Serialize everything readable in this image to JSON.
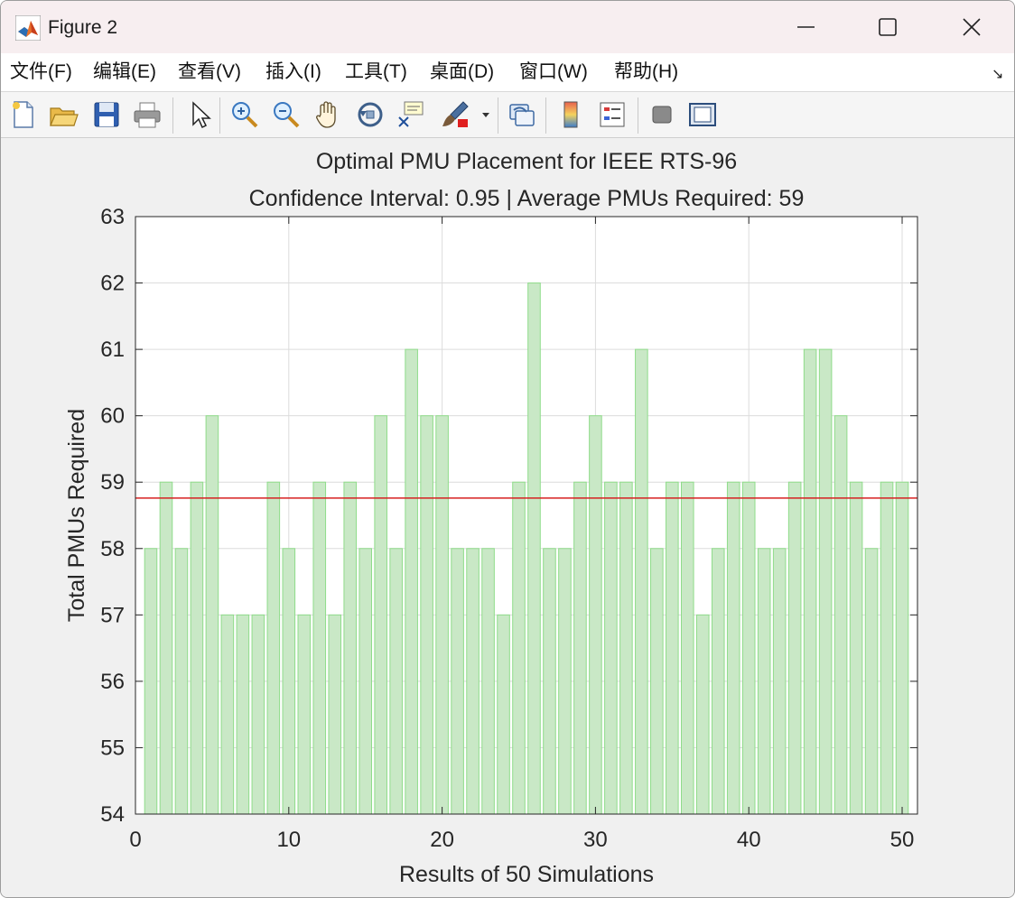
{
  "window": {
    "title": "Figure 2",
    "icon": "matlab-icon"
  },
  "menu": {
    "items": [
      "文件(F)",
      "编辑(E)",
      "查看(V)",
      "插入(I)",
      "工具(T)",
      "桌面(D)",
      "窗口(W)",
      "帮助(H)"
    ]
  },
  "toolbar": {
    "buttons": [
      "new-figure-icon",
      "open-file-icon",
      "save-icon",
      "print-icon",
      "pointer-icon",
      "zoom-in-icon",
      "zoom-out-icon",
      "pan-hand-icon",
      "rotate-3d-icon",
      "data-cursor-icon",
      "brush-icon",
      "dropdown-arrow-icon",
      "link-plot-icon",
      "colorbar-icon",
      "legend-icon",
      "hide-plot-tools-icon",
      "show-plot-tools-icon"
    ]
  },
  "chart_data": {
    "type": "bar",
    "title": "Optimal PMU Placement for IEEE RTS-96",
    "subtitle": "Confidence Interval: 0.95 | Average PMUs Required: 59",
    "xlabel": "Results of 50 Simulations",
    "ylabel": "Total PMUs Required",
    "xlim": [
      0,
      51
    ],
    "ylim": [
      54,
      63
    ],
    "xticks": [
      0,
      10,
      20,
      30,
      40,
      50
    ],
    "yticks": [
      54,
      55,
      56,
      57,
      58,
      59,
      60,
      61,
      62,
      63
    ],
    "grid": true,
    "x": [
      1,
      2,
      3,
      4,
      5,
      6,
      7,
      8,
      9,
      10,
      11,
      12,
      13,
      14,
      15,
      16,
      17,
      18,
      19,
      20,
      21,
      22,
      23,
      24,
      25,
      26,
      27,
      28,
      29,
      30,
      31,
      32,
      33,
      34,
      35,
      36,
      37,
      38,
      39,
      40,
      41,
      42,
      43,
      44,
      45,
      46,
      47,
      48,
      49,
      50
    ],
    "values": [
      58,
      59,
      58,
      59,
      60,
      57,
      57,
      57,
      59,
      58,
      57,
      59,
      57,
      59,
      58,
      60,
      58,
      61,
      60,
      60,
      58,
      58,
      58,
      57,
      59,
      62,
      58,
      58,
      59,
      60,
      59,
      59,
      61,
      58,
      59,
      59,
      57,
      58,
      59,
      59,
      58,
      58,
      59,
      61,
      61,
      60,
      59,
      58,
      59,
      59
    ],
    "mean_line": 58.76,
    "bar_color": "#c9e8c6",
    "bar_edge_color": "#8fdc8a",
    "mean_line_color": "#d62020"
  }
}
